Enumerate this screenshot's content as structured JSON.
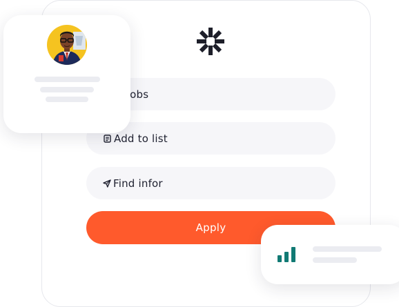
{
  "main": {
    "pills": {
      "jobs_label": "er jobs",
      "list_label": "Add to list",
      "find_label": "Find infor"
    },
    "apply_label": "Apply"
  },
  "colors": {
    "accent": "#ff5a2c",
    "stats_bar": "#117a74",
    "pill_background": "#f6f6f9",
    "skeleton": "#ebecf1"
  },
  "icons": {
    "logo": "asterisk-logo-icon",
    "list": "clipboard-icon",
    "find": "send-icon",
    "stats": "bar-chart-icon"
  }
}
